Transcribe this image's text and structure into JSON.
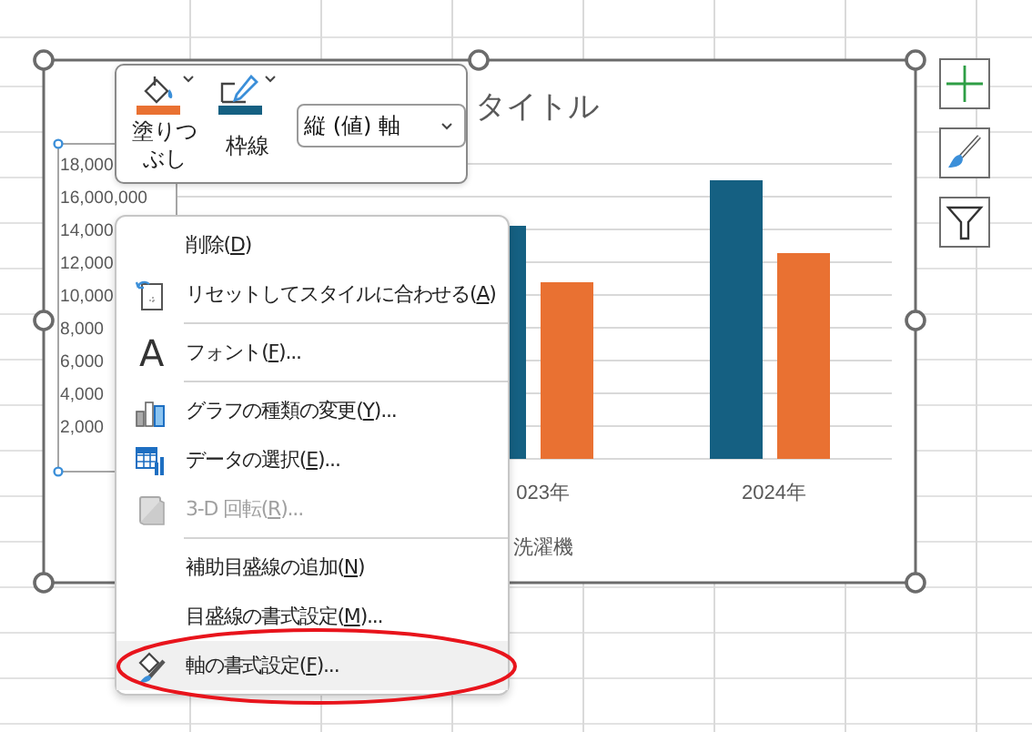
{
  "chart": {
    "title": "タイトル",
    "axis_labels": [
      "18,000",
      "16,000,000",
      "14,000",
      "12,000",
      "10,000",
      "8,000",
      "6,000",
      "4,000",
      "2,000"
    ],
    "category_labels": [
      "023年",
      "2024年"
    ],
    "legend": [
      "洗濯機"
    ]
  },
  "format_toolbar": {
    "buttons": [
      {
        "label": "塗りつぶし",
        "color": "#e97132"
      },
      {
        "label": "枠線",
        "color": "#156082"
      }
    ],
    "element_dropdown": {
      "value": "縦 (値) 軸"
    }
  },
  "context_menu": {
    "items": [
      {
        "kind": "item",
        "before": "削除(",
        "key": "D",
        "after": ")",
        "disabled": false,
        "selected": false,
        "circled": false
      },
      {
        "kind": "item",
        "before": "リセットしてスタイルに合わせる(",
        "key": "A",
        "after": ")",
        "disabled": false,
        "selected": false,
        "circled": false
      },
      {
        "kind": "separator"
      },
      {
        "kind": "item",
        "glyph": "A",
        "before": "フォント(",
        "key": "F",
        "after": ")...",
        "disabled": false,
        "selected": false,
        "circled": false
      },
      {
        "kind": "separator"
      },
      {
        "kind": "item",
        "before": "グラフの種類の変更(",
        "key": "Y",
        "after": ")...",
        "disabled": false,
        "selected": false,
        "circled": false
      },
      {
        "kind": "item",
        "before": "データの選択(",
        "key": "E",
        "after": ")...",
        "disabled": false,
        "selected": false,
        "circled": false
      },
      {
        "kind": "item",
        "before": "3-D 回転(",
        "key": "R",
        "after": ")...",
        "disabled": true,
        "selected": false,
        "circled": false
      },
      {
        "kind": "separator"
      },
      {
        "kind": "item",
        "before": "補助目盛線の追加(",
        "key": "N",
        "after": ")",
        "disabled": false,
        "selected": false,
        "circled": false
      },
      {
        "kind": "item",
        "before": "目盛線の書式設定(",
        "key": "M",
        "after": ")...",
        "disabled": false,
        "selected": false,
        "circled": false
      },
      {
        "kind": "item",
        "before": "軸の書式設定(",
        "key": "F",
        "after": ")...",
        "disabled": false,
        "selected": true,
        "circled": true
      }
    ]
  }
}
